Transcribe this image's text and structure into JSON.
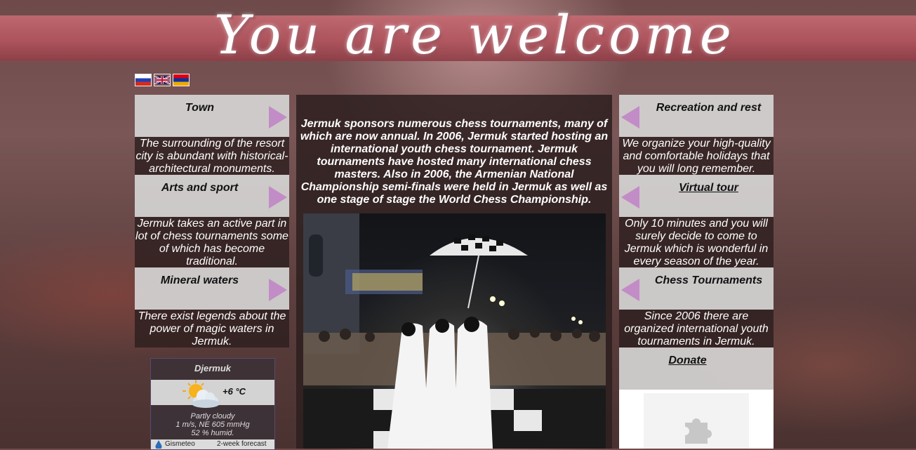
{
  "header": {
    "title": "You are welcome"
  },
  "languages": [
    {
      "icon": "flag-russia-icon"
    },
    {
      "icon": "flag-uk-icon"
    },
    {
      "icon": "flag-armenia-icon"
    }
  ],
  "left_column": [
    {
      "title": "Town",
      "text": "The surrounding of the resort city is abundant with historical-architectural monuments."
    },
    {
      "title": "Arts and sport",
      "text": "Jermuk takes an active part in lot of chess tournaments some of which has become traditional."
    },
    {
      "title": "Mineral waters",
      "text": "There exist legends about the power of magic waters in Jermuk."
    }
  ],
  "weather": {
    "city": "Djermuk",
    "temperature": "+6 °C",
    "condition": "Partly cloudy",
    "wind_pressure": "1 m/s, NE  605 mmHg",
    "humidity": "52 % humid.",
    "provider": "Gismeteo",
    "forecast_link": "2-week forecast"
  },
  "center": {
    "text": "Jermuk sponsors numerous chess tournaments, many of which are now annual. In 2006, Jermuk started hosting an international youth chess tournament. Jermuk tournaments have hosted many international chess masters. Also in 2006, the Armenian National Championship semi-finals were held in Jermuk as well as one stage of stage the World Chess Championship."
  },
  "right_column": [
    {
      "title": "Recreation and rest",
      "text": "We organize your high-quality and comfortable holidays that you will long remember."
    },
    {
      "title": "Virtual tour",
      "text": "Only 10 minutes and you will surely decide to come to Jermuk which is wonderful in every season of the year."
    },
    {
      "title": "Chess Tournaments",
      "text": "Since 2006 there are organized international youth tournaments in Jermuk."
    }
  ],
  "donate": {
    "label": "Donate"
  },
  "colors": {
    "banner": "#b2545e",
    "arrow": "#c28cc6",
    "panel_dark": "#2d1e1e",
    "panel_light": "#d7d7d7"
  }
}
